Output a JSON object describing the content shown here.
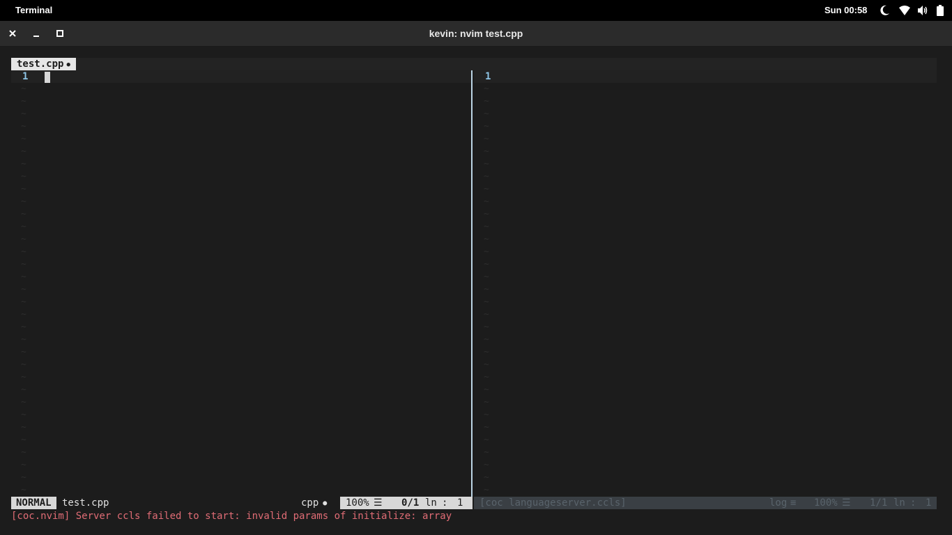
{
  "topbar": {
    "app_name": "Terminal",
    "clock": "Sun 00:58",
    "icons": [
      "night-light-icon",
      "wifi-icon",
      "volume-icon",
      "battery-icon"
    ]
  },
  "window": {
    "title": "kevin: nvim test.cpp",
    "controls": [
      "close-icon",
      "minimize-icon",
      "maximize-icon"
    ]
  },
  "editor": {
    "tab": {
      "label": "test.cpp",
      "modified_marker": "●"
    },
    "left_pane": {
      "line_number": "1",
      "filler": "~"
    },
    "right_pane": {
      "line_number": "1",
      "filler": "~"
    },
    "colors": {
      "accent": "#8ec5e6",
      "error": "#e06c75",
      "background": "#1c1c1c"
    }
  },
  "statusline_left": {
    "mode": "NORMAL",
    "filename": "test.cpp",
    "filetype": "cpp",
    "filetype_icon": "●",
    "percent": "100%",
    "percent_icon": "☰",
    "line_info": "0/1",
    "ln_label": "ln",
    "colon": ":",
    "col": "1"
  },
  "statusline_right": {
    "buffer": "[coc languageserver.ccls]",
    "filetype": "log",
    "filetype_icon": "≡",
    "percent": "100%",
    "percent_icon": "☰",
    "line_info": "1/1",
    "ln_label": "ln",
    "colon": ":",
    "col": "1"
  },
  "message": "[coc.nvim] Server ccls failed to start: invalid params of initialize: array"
}
